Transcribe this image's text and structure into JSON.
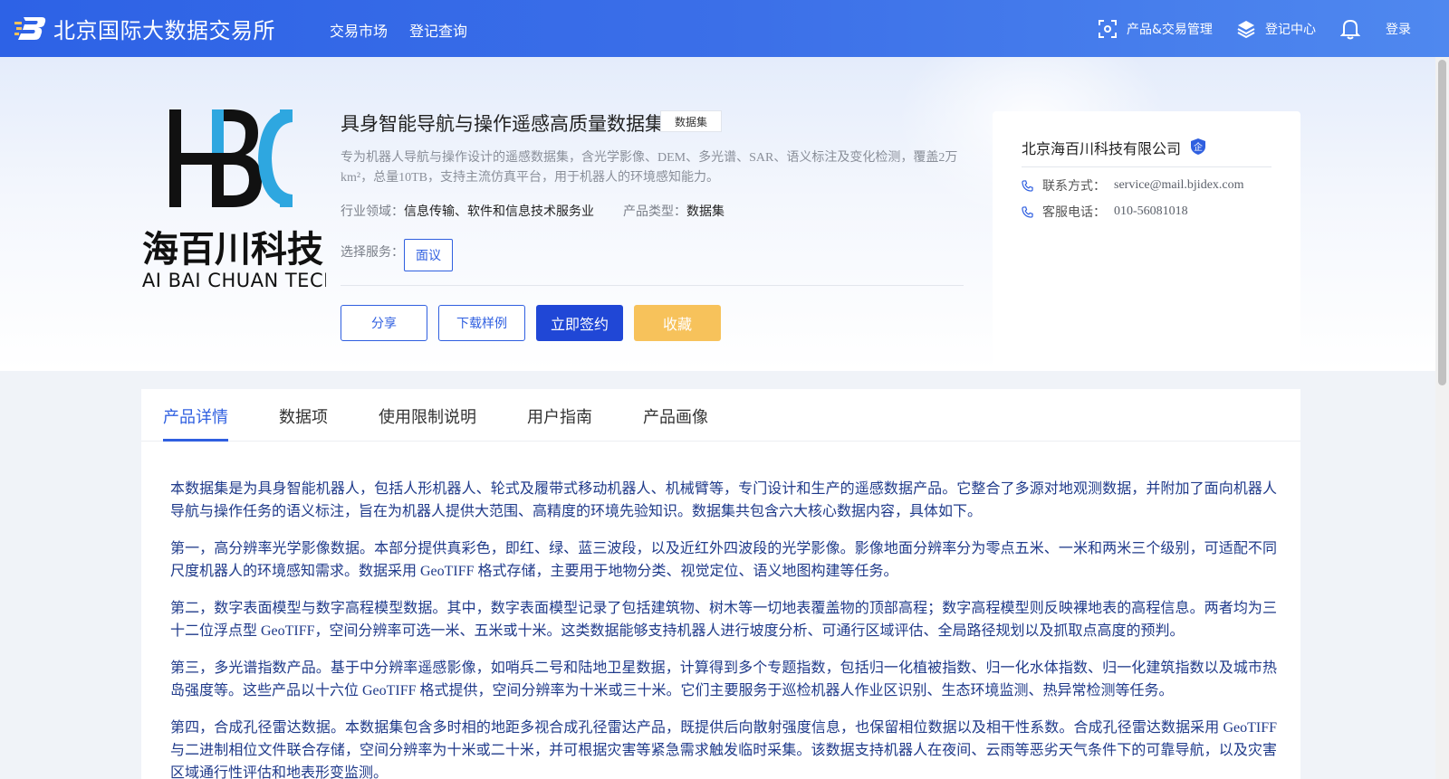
{
  "header": {
    "site_name": "北京国际大数据交易所",
    "nav": [
      "交易市场",
      "登记查询"
    ],
    "product_mgmt": "产品&交易管理",
    "register_center": "登记中心",
    "login": "登录"
  },
  "product": {
    "title": "具身智能导航与操作遥感高质量数据集",
    "type_tag": "数据集",
    "description": "专为机器人导航与操作设计的遥感数据集，含光学影像、DEM、多光谱、SAR、语义标注及变化检测，覆盖2万km²，总量10TB，支持主流仿真平台，用于机器人的环境感知能力。",
    "industry_label": "行业领域：",
    "industry_value": "信息传输、软件和信息技术服务业",
    "ptype_label": "产品类型：",
    "ptype_value": "数据集",
    "service_label": "选择服务：",
    "service_option": "面议"
  },
  "company_logo": {
    "line1": "海百川科技",
    "line2": "HAI BAI CHUAN TECH"
  },
  "buttons": {
    "share": "分享",
    "download_sample": "下载样例",
    "sign_now": "立即签约",
    "favorite": "收藏"
  },
  "seller": {
    "name": "北京海百川科技有限公司",
    "badge": "企",
    "contact_label": "联系方式：",
    "contact_value": "service@mail.bjidex.com",
    "phone_label": "客服电话：",
    "phone_value": "010-56081018"
  },
  "tabs": [
    "产品详情",
    "数据项",
    "使用限制说明",
    "用户指南",
    "产品画像"
  ],
  "active_tab": "产品详情",
  "article": [
    "本数据集是为具身智能机器人，包括人形机器人、轮式及履带式移动机器人、机械臂等，专门设计和生产的遥感数据产品。它整合了多源对地观测数据，并附加了面向机器人导航与操作任务的语义标注，旨在为机器人提供大范围、高精度的环境先验知识。数据集共包含六大核心数据内容，具体如下。",
    "第一，高分辨率光学影像数据。本部分提供真彩色，即红、绿、蓝三波段，以及近红外四波段的光学影像。影像地面分辨率分为零点五米、一米和两米三个级别，可适配不同尺度机器人的环境感知需求。数据采用 GeoTIFF 格式存储，主要用于地物分类、视觉定位、语义地图构建等任务。",
    "第二，数字表面模型与数字高程模型数据。其中，数字表面模型记录了包括建筑物、树木等一切地表覆盖物的顶部高程；数字高程模型则反映裸地表的高程信息。两者均为三十二位浮点型 GeoTIFF，空间分辨率可选一米、五米或十米。这类数据能够支持机器人进行坡度分析、可通行区域评估、全局路径规划以及抓取点高度的预判。",
    "第三，多光谱指数产品。基于中分辨率遥感影像，如哨兵二号和陆地卫星数据，计算得到多个专题指数，包括归一化植被指数、归一化水体指数、归一化建筑指数以及城市热岛强度等。这些产品以十六位 GeoTIFF 格式提供，空间分辨率为十米或三十米。它们主要服务于巡检机器人作业区识别、生态环境监测、热异常检测等任务。",
    "第四，合成孔径雷达数据。本数据集包含多时相的地距多视合成孔径雷达产品，既提供后向散射强度信息，也保留相位数据以及相干性系数。合成孔径雷达数据采用 GeoTIFF 与二进制相位文件联合存储，空间分辨率为十米或二十米，并可根据灾害等紧急需求触发临时采集。该数据支持机器人在夜间、云雨等恶劣天气条件下的可靠导航，以及灾害区域通行性评估和地表形变监测。"
  ],
  "colors": {
    "header_blue": "#2d62e6",
    "accent_blue": "#2f5fe0",
    "primary_button": "#2047d6",
    "favorite_yellow": "#f7c25b",
    "logo_cyan": "#2ea7e0"
  }
}
